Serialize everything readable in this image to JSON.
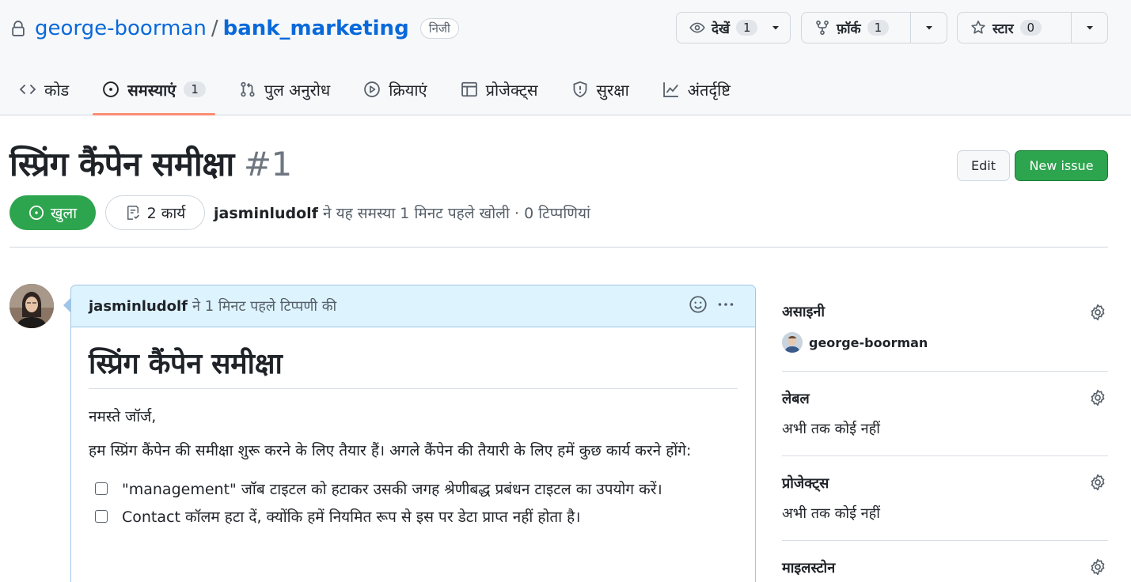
{
  "repo": {
    "owner": "george-boorman",
    "separator": "/",
    "name": "bank_marketing",
    "visibility": "निजी",
    "actions": [
      {
        "label": "देखें",
        "count": "1",
        "icon": "eye-icon"
      },
      {
        "label": "फ़ॉर्क",
        "count": "1",
        "icon": "fork-icon"
      },
      {
        "label": "स्टार",
        "count": "0",
        "icon": "star-icon"
      }
    ]
  },
  "tabs": [
    {
      "label": "कोड",
      "icon": "code-icon"
    },
    {
      "label": "समस्याएं",
      "count": "1",
      "icon": "issue-icon",
      "active": true
    },
    {
      "label": "पुल अनुरोध",
      "icon": "pull-request-icon"
    },
    {
      "label": "क्रियाएं",
      "icon": "play-icon"
    },
    {
      "label": "प्रोजेक्ट्स",
      "icon": "table-icon"
    },
    {
      "label": "सुरक्षा",
      "icon": "shield-icon"
    },
    {
      "label": "अंतर्दृष्टि",
      "icon": "graph-icon"
    }
  ],
  "issue": {
    "title": "स्प्रिंग कैंपेन समीक्षा",
    "number": "#1",
    "edit_label": "Edit",
    "new_issue_label": "New issue",
    "state": "खुला",
    "tasks": "2 कार्य",
    "author": "jasminludolf",
    "meta": "ने यह समस्या 1 मिनट पहले खोली · 0 टिप्पणियां"
  },
  "comment": {
    "author": "jasminludolf",
    "meta": "ने 1 मिनट पहले टिप्पणी की",
    "heading": "स्प्रिंग कैंपेन समीक्षा",
    "greeting": "नमस्ते जॉर्ज,",
    "paragraph": "हम स्प्रिंग कैंपेन की समीक्षा शुरू करने के लिए तैयार हैं। अगले कैंपेन की तैयारी के लिए हमें कुछ कार्य करने होंगे:",
    "tasks": [
      "\"management\" जॉब टाइटल को हटाकर उसकी जगह श्रेणीबद्ध प्रबंधन टाइटल का उपयोग करें।",
      "Contact कॉलम हटा दें, क्योंकि हमें नियमित रूप से इस पर डेटा प्राप्त नहीं होता है।"
    ]
  },
  "sidebar": {
    "assignees": {
      "heading": "असाइनी",
      "user": "george-boorman"
    },
    "labels": {
      "heading": "लेबल",
      "value": "अभी तक कोई नहीं"
    },
    "projects": {
      "heading": "प्रोजेक्ट्स",
      "value": "अभी तक कोई नहीं"
    },
    "milestone": {
      "heading": "माइलस्टोन"
    }
  },
  "colors": {
    "link": "#0969da",
    "open_green": "#2da44e",
    "active_tab_underline": "#fd8c73",
    "comment_header": "#ddf4ff"
  }
}
